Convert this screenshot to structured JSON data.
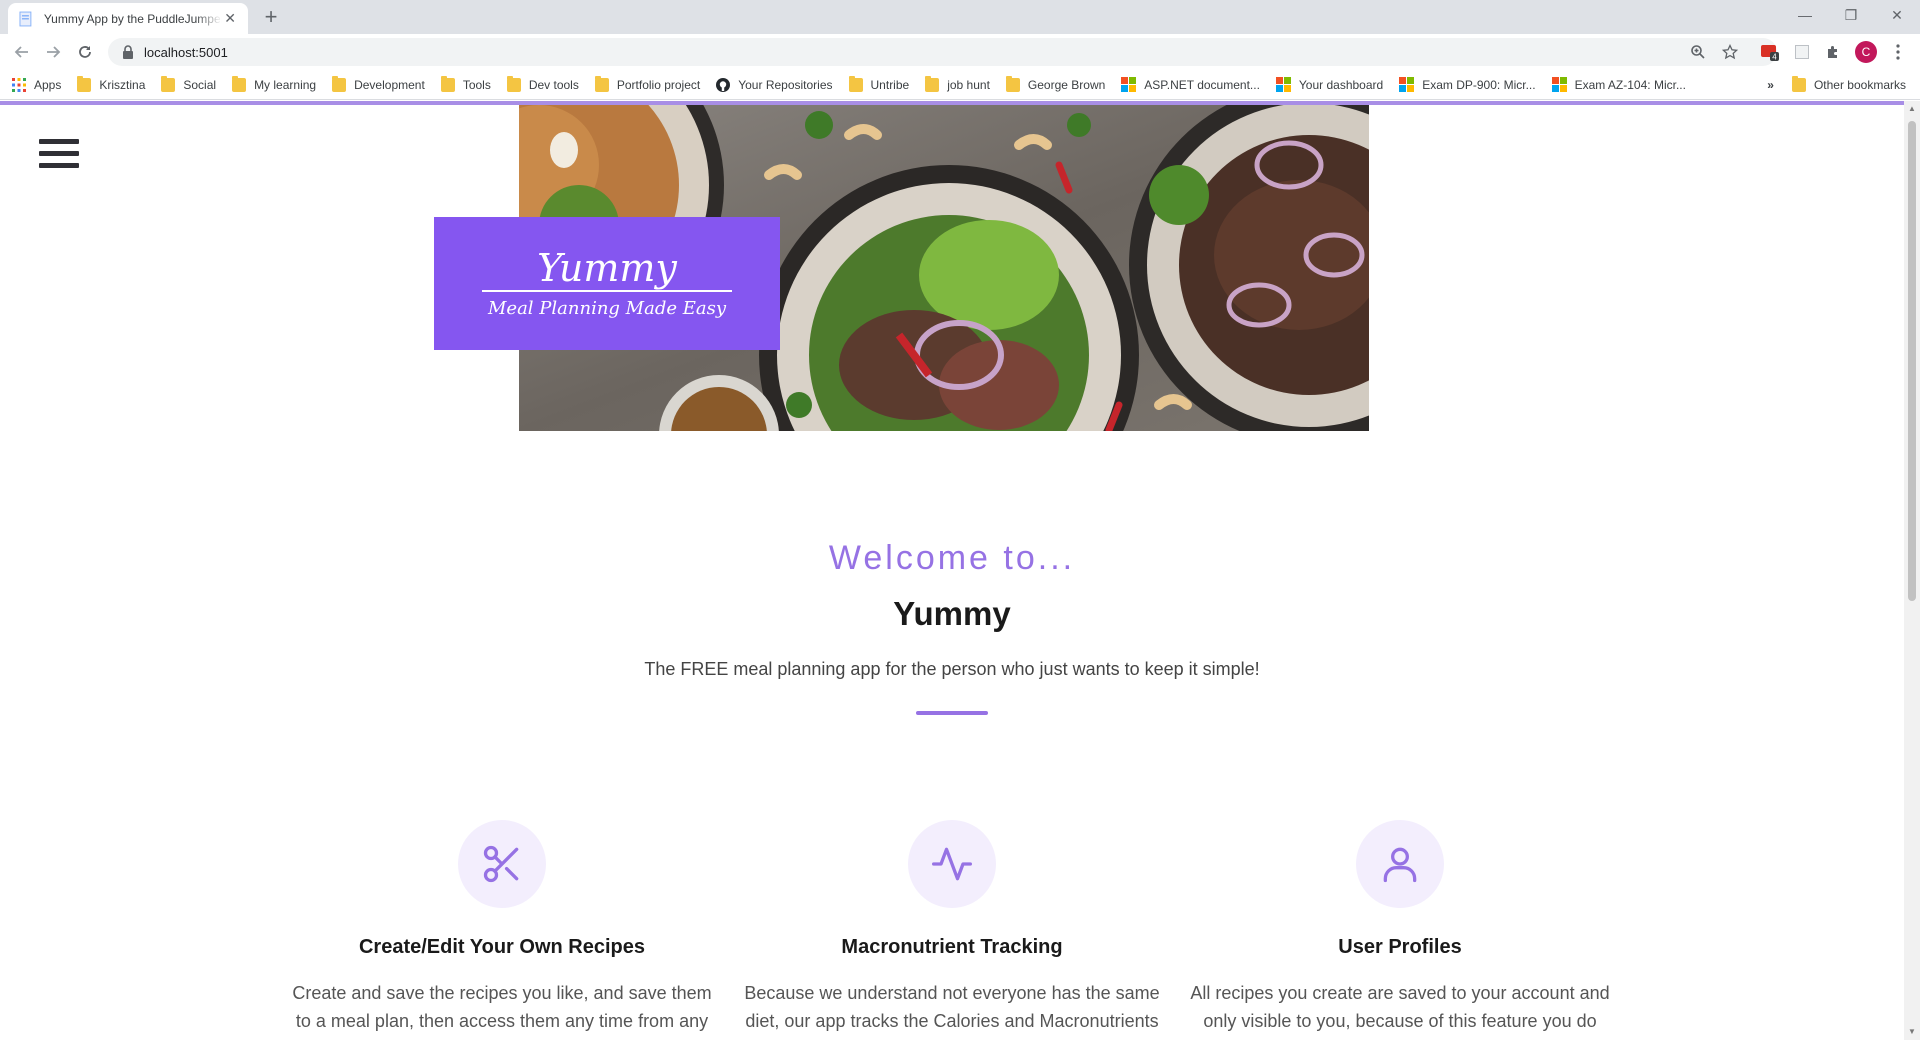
{
  "browser": {
    "tab_title": "Yummy App by the PuddleJumpers",
    "url": "localhost:5001",
    "profile_initial": "C",
    "extension_badge": "4"
  },
  "bookmarks": [
    {
      "label": "Apps",
      "icon": "apps-grid-icon"
    },
    {
      "label": "Krisztina",
      "icon": "folder-icon"
    },
    {
      "label": "Social",
      "icon": "folder-icon"
    },
    {
      "label": "My learning",
      "icon": "folder-icon"
    },
    {
      "label": "Development",
      "icon": "folder-icon"
    },
    {
      "label": "Tools",
      "icon": "folder-icon"
    },
    {
      "label": "Dev tools",
      "icon": "folder-icon"
    },
    {
      "label": "Portfolio project",
      "icon": "folder-icon"
    },
    {
      "label": "Your Repositories",
      "icon": "github-icon"
    },
    {
      "label": "Untribe",
      "icon": "folder-icon"
    },
    {
      "label": "job hunt",
      "icon": "folder-icon"
    },
    {
      "label": "George Brown",
      "icon": "folder-icon"
    },
    {
      "label": "ASP.NET document...",
      "icon": "microsoft-icon"
    },
    {
      "label": "Your dashboard",
      "icon": "microsoft-icon"
    },
    {
      "label": "Exam DP-900: Micr...",
      "icon": "microsoft-icon"
    },
    {
      "label": "Exam AZ-104: Micr...",
      "icon": "microsoft-icon"
    }
  ],
  "bookmarks_overflow": "»",
  "other_bookmarks": "Other bookmarks",
  "hero": {
    "logo_title": "Yummy",
    "logo_subtitle": "Meal Planning Made Easy"
  },
  "intro": {
    "welcome": "Welcome to...",
    "app_name": "Yummy",
    "tagline": "The FREE meal planning app for the person who just wants to keep it simple!"
  },
  "features": [
    {
      "icon": "scissors-icon",
      "title": "Create/Edit Your Own Recipes",
      "text": "Create and save the recipes you like, and save them to a meal plan, then access them any time from any device!"
    },
    {
      "icon": "activity-icon",
      "title": "Macronutrient Tracking",
      "text": "Because we understand not everyone has the same diet, our app tracks the Calories and Macronutrients for chosen recipes, so you can use that information to help"
    },
    {
      "icon": "user-icon",
      "title": "User Profiles",
      "text": "All recipes you create are saved to your account and only visible to you, because of this feature you do not have to worry about your recipe list, and can help"
    }
  ],
  "colors": {
    "accent": "#9672e4",
    "logo_bg": "#8556f0",
    "icon_circle": "#f3eefd"
  }
}
